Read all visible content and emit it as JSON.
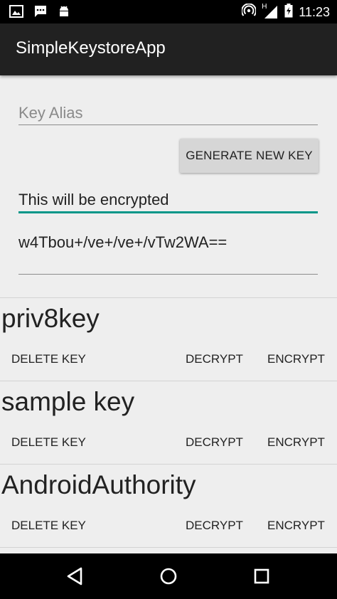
{
  "status_bar": {
    "time": "11:23",
    "network": "H",
    "icons": [
      "image-icon",
      "chat-icon",
      "android-icon",
      "hotspot-icon",
      "signal-icon",
      "battery-charging-icon"
    ]
  },
  "app_bar": {
    "title": "SimpleKeystoreApp"
  },
  "form": {
    "alias_placeholder": "Key Alias",
    "alias_value": "",
    "generate_label": "GENERATE NEW KEY",
    "plain_text": "This will be encrypted",
    "cipher_text": "w4Tbou+/ve+/ve+/vTw2WA=="
  },
  "keys": [
    {
      "name": "priv8key",
      "delete_label": "DELETE KEY",
      "decrypt_label": "DECRYPT",
      "encrypt_label": "ENCRYPT"
    },
    {
      "name": "sample key",
      "delete_label": "DELETE KEY",
      "decrypt_label": "DECRYPT",
      "encrypt_label": "ENCRYPT"
    },
    {
      "name": "AndroidAuthority",
      "delete_label": "DELETE KEY",
      "decrypt_label": "DECRYPT",
      "encrypt_label": "ENCRYPT"
    }
  ],
  "nav_bar": {
    "icons": [
      "back-icon",
      "home-icon",
      "recents-icon"
    ]
  },
  "colors": {
    "accent": "#009688",
    "app_bar": "#212121",
    "background": "#eeeeee"
  }
}
